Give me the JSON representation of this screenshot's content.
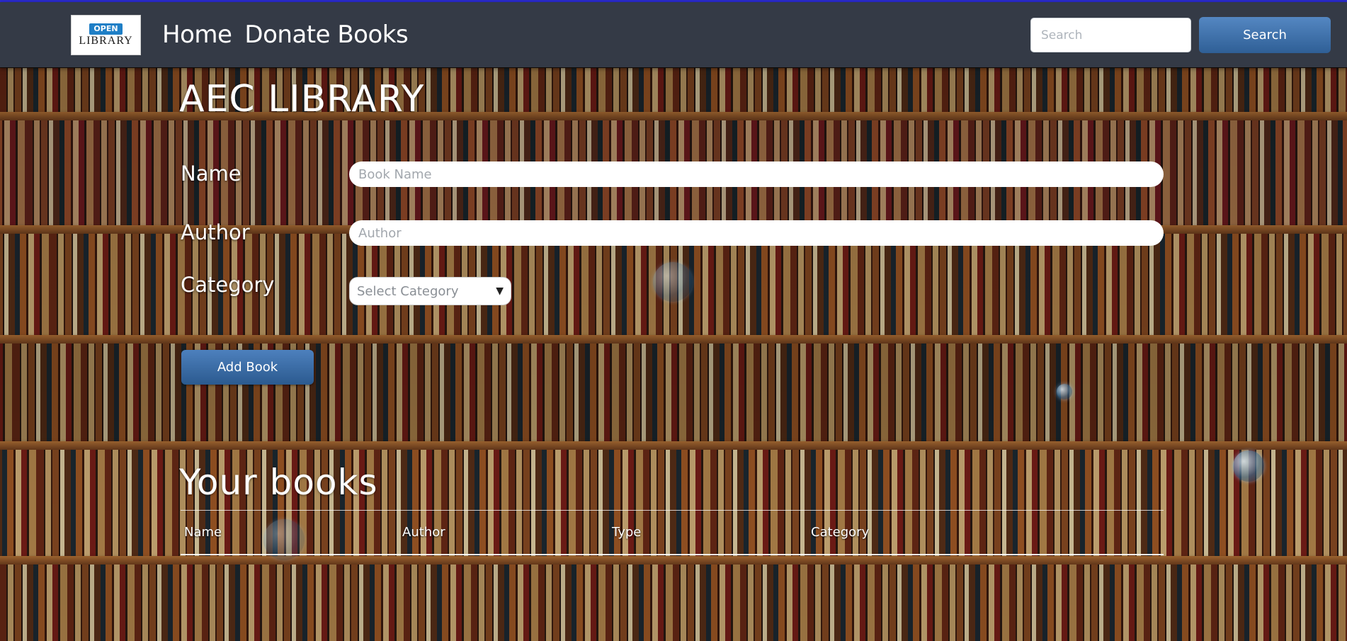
{
  "navbar": {
    "logo": {
      "line1": "OPEN",
      "line2": "LIBRARY"
    },
    "links": [
      {
        "label": "Home"
      },
      {
        "label": "Donate Books"
      }
    ],
    "search": {
      "placeholder": "Search",
      "value": "",
      "button_label": "Search"
    }
  },
  "main": {
    "title": "AEC LIBRARY",
    "form": {
      "name": {
        "label": "Name",
        "placeholder": "Book Name",
        "value": ""
      },
      "author": {
        "label": "Author",
        "placeholder": "Author",
        "value": ""
      },
      "category": {
        "label": "Category",
        "selected": "Select Category"
      },
      "submit_label": "Add Book"
    },
    "books": {
      "title": "Your books",
      "columns": [
        "Name",
        "Author",
        "Type",
        "Category"
      ],
      "rows": []
    }
  },
  "colors": {
    "navbar_bg": "#343a46",
    "top_accent": "#2b2bd0",
    "button_blue": "#2f5f96"
  }
}
